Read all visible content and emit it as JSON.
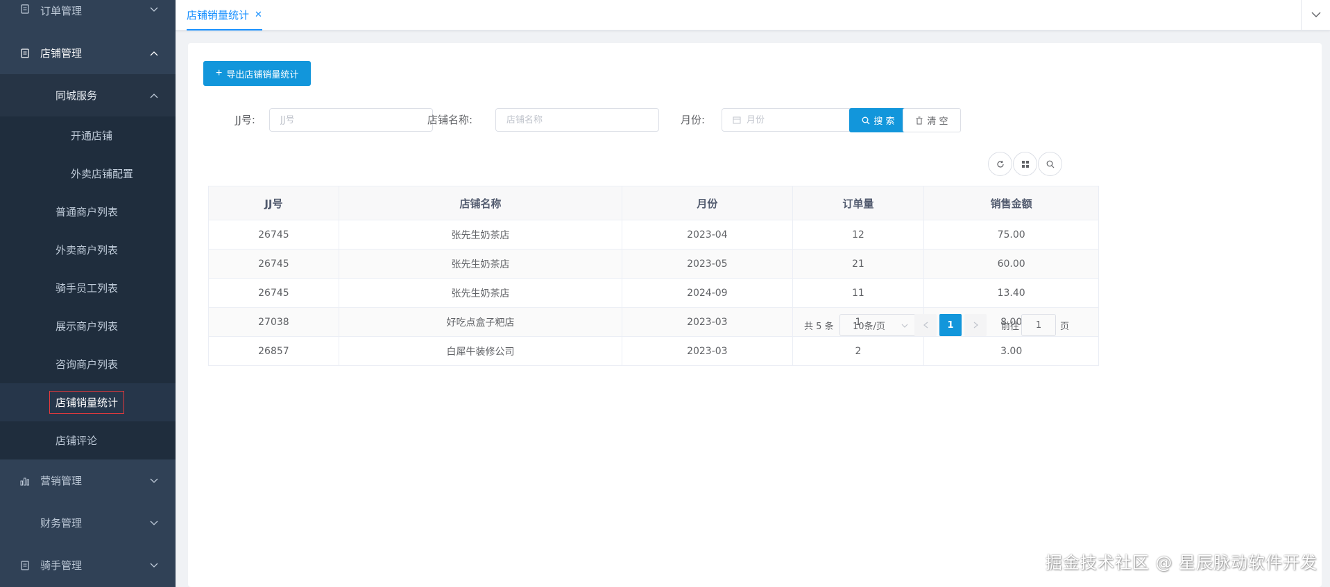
{
  "colors": {
    "sidebar_bg": "#304156",
    "primary": "#1296db",
    "active_tab": "#1890ff"
  },
  "sidebar": {
    "order_mgmt": {
      "label": "订单管理",
      "icon": "document-icon"
    },
    "shop_mgmt": {
      "label": "店铺管理",
      "icon": "document-icon"
    },
    "city_service": {
      "label": "同城服务"
    },
    "city_items": [
      "开通店铺",
      "外卖店铺配置"
    ],
    "shop_items": [
      "普通商户列表",
      "外卖商户列表",
      "骑手员工列表",
      "展示商户列表",
      "咨询商户列表",
      "店铺销量统计",
      "店铺评论"
    ],
    "marketing_mgmt": {
      "label": "营销管理",
      "icon": "bar-chart-icon"
    },
    "finance_mgmt": {
      "label": "财务管理"
    },
    "rider_mgmt": {
      "label": "骑手管理",
      "icon": "document-icon"
    }
  },
  "tabs": {
    "active_label": "店铺销量统计",
    "close_glyph": "✕"
  },
  "toolbar": {
    "export_label": "导出店铺销量统计"
  },
  "filters": {
    "jj_label": "JJ号:",
    "jj_placeholder": "JJ号",
    "shop_label": "店铺名称:",
    "shop_placeholder": "店铺名称",
    "month_label": "月份:",
    "month_placeholder": "月份",
    "search_label": "搜 索",
    "clear_label": "清 空"
  },
  "table": {
    "headers": [
      "JJ号",
      "店铺名称",
      "月份",
      "订单量",
      "销售金额"
    ],
    "rows": [
      [
        "26745",
        "张先生奶茶店",
        "2023-04",
        "12",
        "75.00"
      ],
      [
        "26745",
        "张先生奶茶店",
        "2023-05",
        "21",
        "60.00"
      ],
      [
        "26745",
        "张先生奶茶店",
        "2024-09",
        "11",
        "13.40"
      ],
      [
        "27038",
        "好吃点盒子粑店",
        "2023-03",
        "1",
        "8.00"
      ],
      [
        "26857",
        "白犀牛装修公司",
        "2023-03",
        "2",
        "3.00"
      ]
    ]
  },
  "pagination": {
    "total": "共 5 条",
    "page_size": "10条/页",
    "current": "1",
    "goto_label": "前往",
    "goto_value": "1",
    "page_suffix": "页"
  },
  "watermark": "掘金技术社区 @ 星辰脉动软件开发"
}
